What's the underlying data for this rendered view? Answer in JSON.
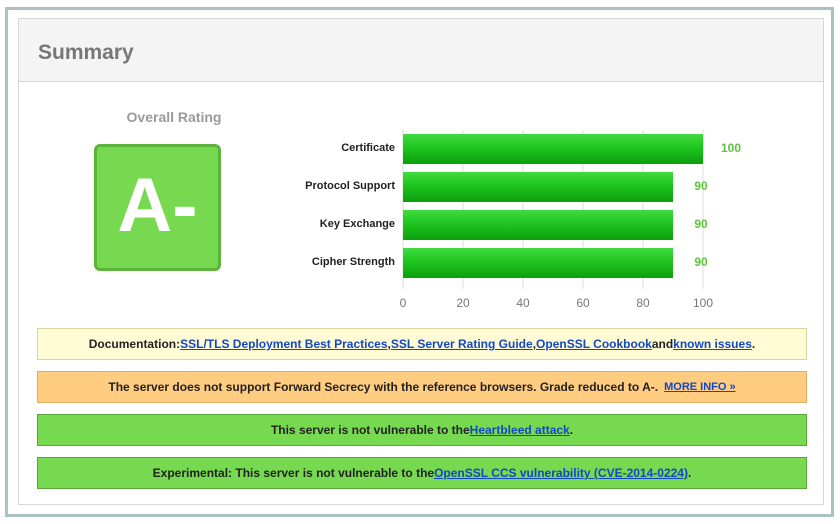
{
  "summary": {
    "title": "Summary",
    "overall_label": "Overall Rating",
    "grade": "A-",
    "grade_color": "#77d94f"
  },
  "chart_data": {
    "type": "bar",
    "orientation": "horizontal",
    "categories": [
      "Certificate",
      "Protocol Support",
      "Key Exchange",
      "Cipher Strength"
    ],
    "values": [
      100,
      90,
      90,
      90
    ],
    "value_labels": [
      "100",
      "90",
      "90",
      "90"
    ],
    "xlim": [
      0,
      100
    ],
    "xticks": [
      "0",
      "20",
      "40",
      "60",
      "80",
      "100"
    ],
    "bar_color": "#1cc21c",
    "grid": true
  },
  "notices": {
    "documentation": {
      "prefix": "Documentation: ",
      "link1": "SSL/TLS Deployment Best Practices",
      "sep1": ", ",
      "link2": "SSL Server Rating Guide",
      "sep2": ", ",
      "link3": "OpenSSL Cookbook",
      "sep3": " and ",
      "link4": "known issues",
      "suffix": "."
    },
    "forward_secrecy": {
      "text": "The server does not support Forward Secrecy with the reference browsers. Grade reduced to A-.",
      "more_info": "MORE INFO »"
    },
    "heartbleed": {
      "prefix": "This server is not vulnerable to the ",
      "link": "Heartbleed attack",
      "suffix": "."
    },
    "ccs": {
      "prefix": "Experimental: This server is not vulnerable to the ",
      "link": "OpenSSL CCS vulnerability (CVE-2014-0224)",
      "suffix": "."
    }
  }
}
